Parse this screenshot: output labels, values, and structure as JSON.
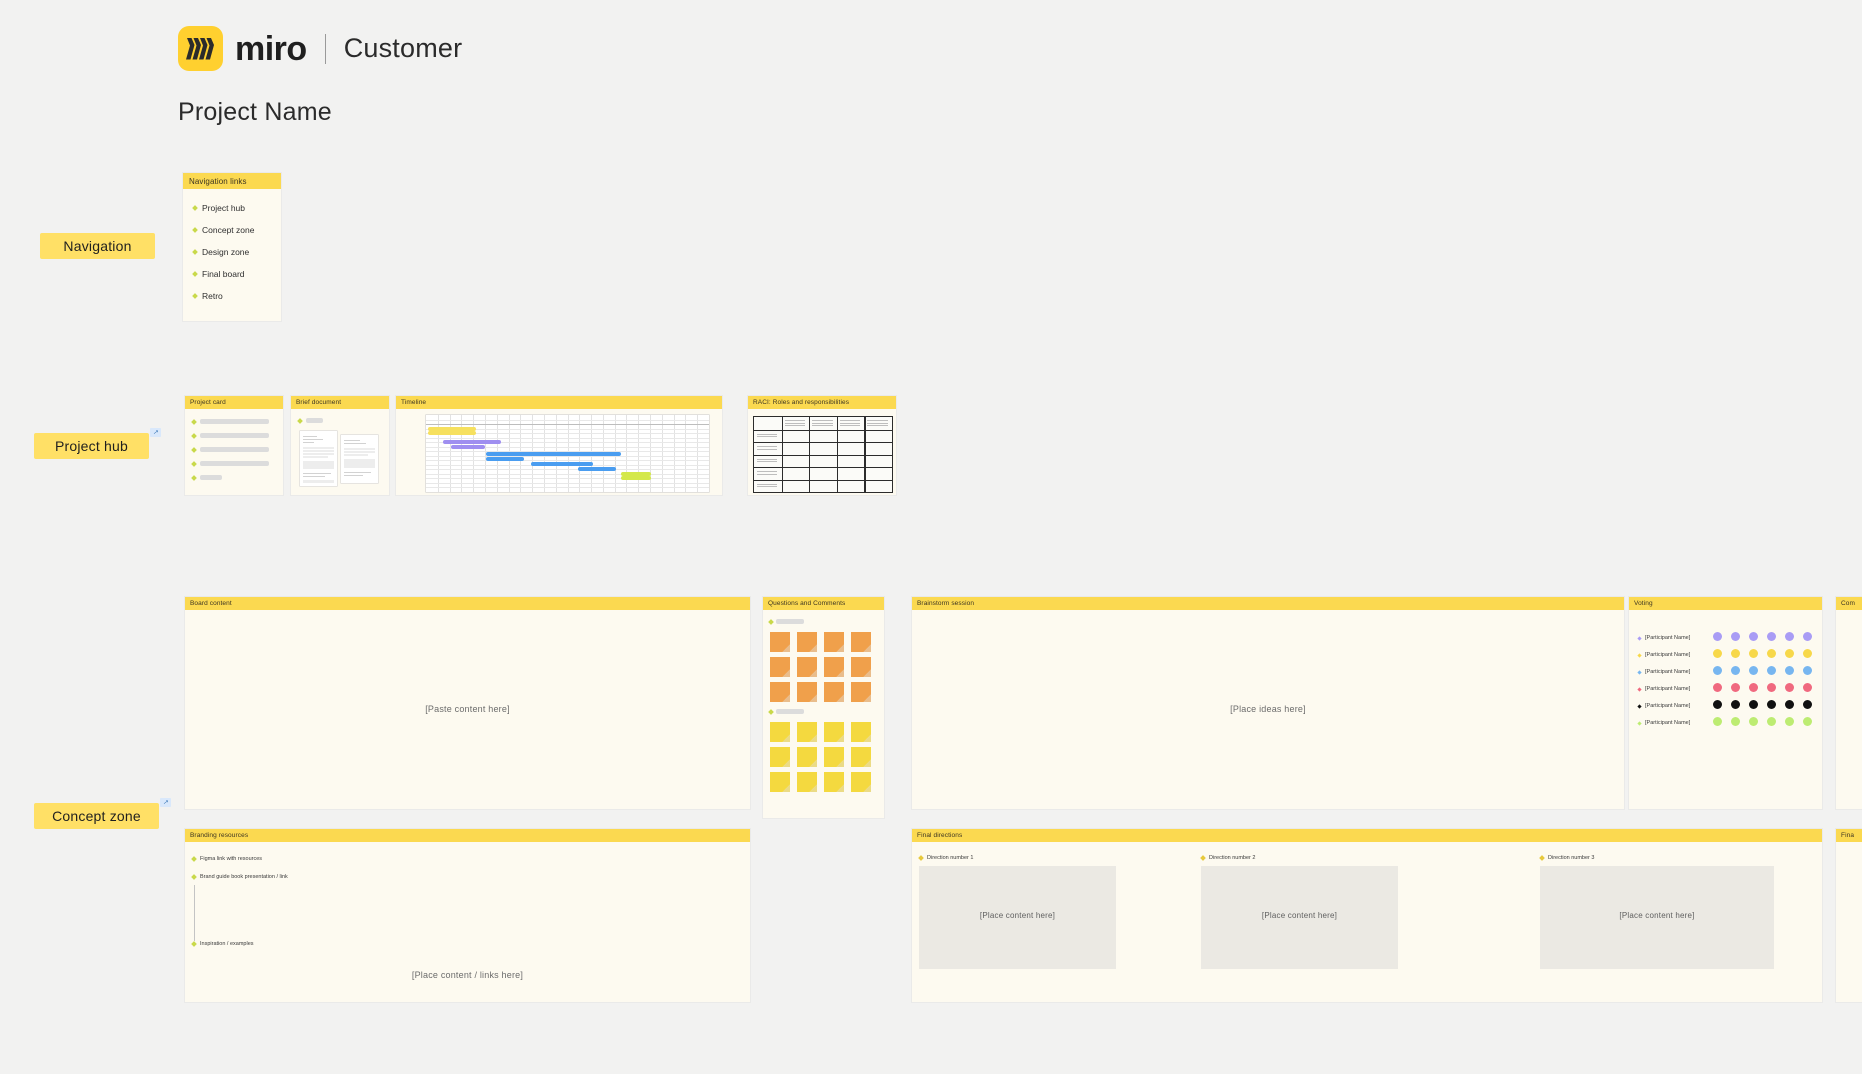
{
  "brand": {
    "logo_icon": "miro-logo-icon",
    "wordmark": "miro",
    "suffix": "Customer"
  },
  "page_title": "Project Name",
  "zones": [
    {
      "id": "navigation",
      "label": "Navigation",
      "has_link_badge": false
    },
    {
      "id": "project-hub",
      "label": "Project hub",
      "has_link_badge": true
    },
    {
      "id": "concept-zone",
      "label": "Concept zone",
      "has_link_badge": true
    }
  ],
  "navigation_card": {
    "title": "Navigation links",
    "items": [
      {
        "label": "Project hub"
      },
      {
        "label": "Concept zone"
      },
      {
        "label": "Design zone"
      },
      {
        "label": "Final board"
      },
      {
        "label": "Retro"
      }
    ]
  },
  "project_hub": {
    "frames": [
      {
        "id": "project-card",
        "title": "Project card"
      },
      {
        "id": "brief-document",
        "title": "Brief document"
      },
      {
        "id": "timeline",
        "title": "Timeline"
      },
      {
        "id": "raci",
        "title": "RACI: Roles and responsibilities"
      }
    ]
  },
  "concept_zone": {
    "board_content": {
      "title": "Board content",
      "placeholder": "[Paste content here]"
    },
    "questions": {
      "title": "Questions and Comments",
      "groups": [
        {
          "color": "#f0a04b",
          "fold": "#d98b3a",
          "rows": 3,
          "cols": 4
        },
        {
          "color": "#f4d93f",
          "fold": "#dcc130",
          "rows": 3,
          "cols": 4
        }
      ]
    },
    "brainstorm": {
      "title": "Brainstorm session",
      "placeholder": "[Place ideas here]"
    },
    "voting": {
      "title": "Voting",
      "participants": [
        {
          "name": "[Participant Name]",
          "color": "#a99cf5"
        },
        {
          "name": "[Participant Name]",
          "color": "#f7d84a"
        },
        {
          "name": "[Participant Name]",
          "color": "#77b6f0"
        },
        {
          "name": "[Participant Name]",
          "color": "#f0697f"
        },
        {
          "name": "[Participant Name]",
          "color": "#111111"
        },
        {
          "name": "[Participant Name]",
          "color": "#bdec72"
        }
      ],
      "votes_per_participant": 6
    },
    "voting_next": {
      "title": "Com"
    },
    "branding": {
      "title": "Branding resources",
      "links": [
        {
          "label": "Figma link with resources"
        },
        {
          "label": "Brand guide book presentation / link"
        },
        {
          "label": "Inspiration / examples"
        }
      ],
      "placeholder": "[Place content / links here]"
    },
    "directions": {
      "title": "Final directions",
      "columns": [
        {
          "label": "Direction number 1",
          "placeholder": "[Place content here]"
        },
        {
          "label": "Direction number 2",
          "placeholder": "[Place content here]"
        },
        {
          "label": "Direction number 3",
          "placeholder": "[Place content here]"
        }
      ]
    },
    "directions_next": {
      "title": "Fina"
    }
  },
  "colors": {
    "canvas": "#f2f2f1",
    "frame_bg": "#fdfaf0",
    "frame_header": "#fbd950",
    "zone_label": "#ffe066",
    "brand_yellow": "#ffd02f"
  }
}
